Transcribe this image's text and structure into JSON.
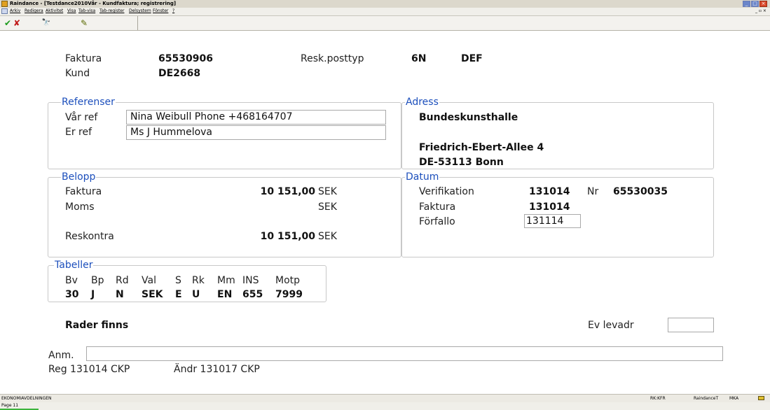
{
  "window": {
    "title": "Raindance - [Testdance2010Vår - Kundfaktura; registrering]",
    "controls": [
      "_",
      "□",
      "×"
    ]
  },
  "menu": [
    "Arkiv",
    "Redigera",
    "Aktivitet",
    "Visa",
    "Tab-visa",
    "Tab-register",
    "Delsystem",
    "Fönster",
    "?"
  ],
  "toolbar": {
    "ok_glyph": "✔",
    "cancel_glyph": "✘",
    "search_glyph": "🔭",
    "edit_glyph": "✎"
  },
  "header": {
    "faktura_label": "Faktura",
    "faktura_value": "65530906",
    "kund_label": "Kund",
    "kund_value": "DE2668",
    "resk_label": "Resk.posttyp",
    "resk_code": "6N",
    "resk_type": "DEF"
  },
  "referenser": {
    "legend": "Referenser",
    "var_ref_label": "Vår ref",
    "var_ref_value": "Nina Weibull Phone +468164707",
    "er_ref_label": "Er ref",
    "er_ref_value": "Ms J Hummelova"
  },
  "adress": {
    "legend": "Adress",
    "name": "Bundeskunsthalle",
    "street": "Friedrich-Ebert-Allee 4",
    "city": "DE-53113 Bonn"
  },
  "belopp": {
    "legend": "Belopp",
    "faktura_label": "Faktura",
    "faktura_amount": "10 151,00",
    "faktura_currency": "SEK",
    "moms_label": "Moms",
    "moms_currency": "SEK",
    "reskontra_label": "Reskontra",
    "reskontra_amount": "10 151,00",
    "reskontra_currency": "SEK"
  },
  "datum": {
    "legend": "Datum",
    "verifikation_label": "Verifikation",
    "verifikation_value": "131014",
    "nr_label": "Nr",
    "nr_value": "65530035",
    "faktura_label": "Faktura",
    "faktura_value": "131014",
    "forfallo_label": "Förfallo",
    "forfallo_value": "131114"
  },
  "tabeller": {
    "legend": "Tabeller",
    "columns": [
      {
        "header": "Bv",
        "value": "30"
      },
      {
        "header": "Bp",
        "value": "J"
      },
      {
        "header": "Rd",
        "value": "N"
      },
      {
        "header": "Val",
        "value": "SEK"
      },
      {
        "header": "S",
        "value": "E"
      },
      {
        "header": "Rk",
        "value": "U"
      },
      {
        "header": "Mm",
        "value": "EN"
      },
      {
        "header": "INS",
        "value": "655"
      },
      {
        "header": "Motp",
        "value": "7999"
      }
    ]
  },
  "rader_finns": "Rader finns",
  "ev_levadr_label": "Ev levadr",
  "ev_levadr_value": "",
  "anm_label": "Anm.",
  "anm_value": "",
  "reg_text": "Reg 131014 CKP",
  "andr_text": "Ändr 131017 CKP",
  "statusbar": {
    "left": "EKONOMIAVDELNINGEN",
    "rk": "RK:KFR",
    "db": "RaindanceT",
    "user": "MKA"
  },
  "pagebar": "Page 11"
}
